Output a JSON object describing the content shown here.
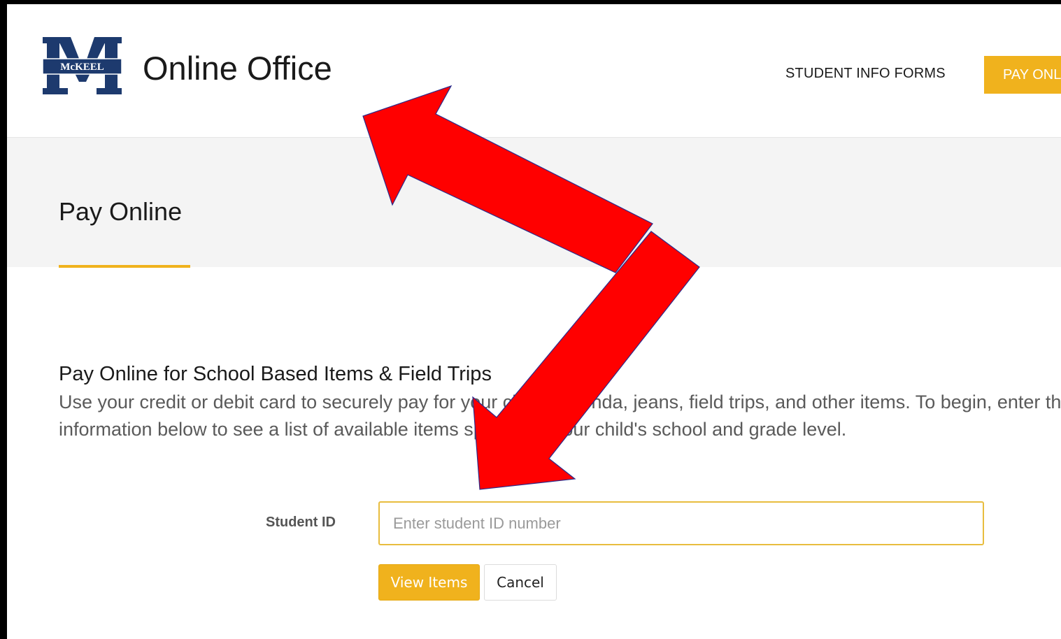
{
  "header": {
    "logo_text": "McKEEL",
    "site_title": "Online Office",
    "nav": {
      "student_info_forms": "STUDENT INFO FORMS",
      "pay_online": "PAY ONLINE"
    }
  },
  "banner": {
    "title": "Pay Online"
  },
  "main": {
    "heading": "Pay Online for School Based Items & Field Trips",
    "description": "Use your credit or debit card to securely pay for your child's agenda, jeans, field trips, and other items. To begin, enter the information below to see a list of available items specific to your child's school and grade level."
  },
  "form": {
    "student_id_label": "Student ID",
    "student_id_value": "",
    "student_id_placeholder": "Enter student ID number",
    "view_items_label": "View Items",
    "cancel_label": "Cancel"
  },
  "colors": {
    "accent": "#f0b21d",
    "brand_navy": "#1d3a6e",
    "annotation_arrow": "#ff0000"
  }
}
